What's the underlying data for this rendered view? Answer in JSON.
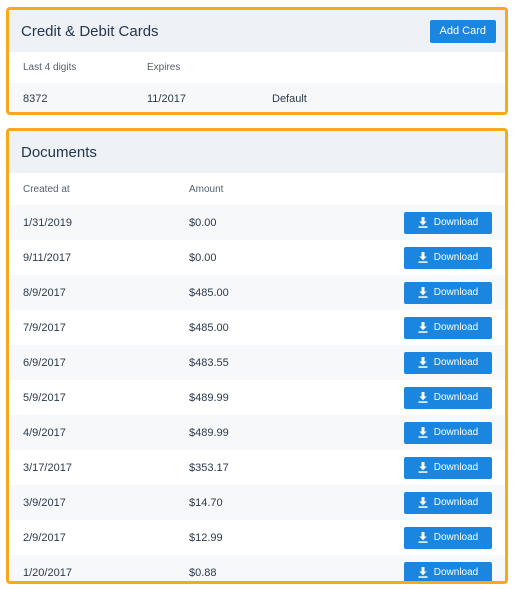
{
  "cards": {
    "title": "Credit & Debit Cards",
    "add_label": "Add Card",
    "columns": [
      "Last 4 digits",
      "Expires"
    ],
    "rows": [
      {
        "last4": "8372",
        "expires": "11/2017",
        "status": "Default"
      }
    ]
  },
  "documents": {
    "title": "Documents",
    "columns": [
      "Created at",
      "Amount"
    ],
    "download_label": "Download",
    "download_icon": "download-icon",
    "rows": [
      {
        "date": "1/31/2019",
        "amount": "$0.00"
      },
      {
        "date": "9/11/2017",
        "amount": "$0.00"
      },
      {
        "date": "8/9/2017",
        "amount": "$485.00"
      },
      {
        "date": "7/9/2017",
        "amount": "$485.00"
      },
      {
        "date": "6/9/2017",
        "amount": "$483.55"
      },
      {
        "date": "5/9/2017",
        "amount": "$489.99"
      },
      {
        "date": "4/9/2017",
        "amount": "$489.99"
      },
      {
        "date": "3/17/2017",
        "amount": "$353.17"
      },
      {
        "date": "3/9/2017",
        "amount": "$14.70"
      },
      {
        "date": "2/9/2017",
        "amount": "$12.99"
      },
      {
        "date": "1/20/2017",
        "amount": "$0.88"
      }
    ]
  },
  "colors": {
    "accent": "#1a86e0",
    "highlight_border": "#f7a81b",
    "header_bg": "#eef2f6"
  }
}
